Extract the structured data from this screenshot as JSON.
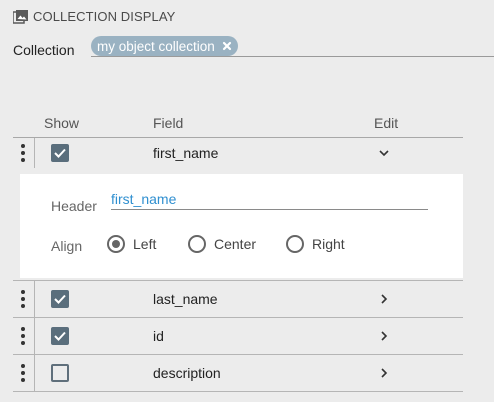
{
  "section": {
    "title": "COLLECTION DISPLAY",
    "icon": "image-icon"
  },
  "collection": {
    "label": "Collection",
    "chip_label": "my object collection",
    "chip_icon": "close-icon"
  },
  "table": {
    "headers": {
      "show": "Show",
      "field": "Field",
      "edit": "Edit"
    },
    "rows": [
      {
        "name": "first_name",
        "checked": true,
        "expanded": true,
        "edit_icon": "chevron-down-icon"
      },
      {
        "name": "last_name",
        "checked": true,
        "expanded": false,
        "edit_icon": "chevron-right-icon"
      },
      {
        "name": "id",
        "checked": true,
        "expanded": false,
        "edit_icon": "chevron-right-icon"
      },
      {
        "name": "description",
        "checked": false,
        "expanded": false,
        "edit_icon": "chevron-right-icon"
      }
    ]
  },
  "detail": {
    "header_label": "Header",
    "header_value": "first_name",
    "align_label": "Align",
    "align_options": [
      "Left",
      "Center",
      "Right"
    ],
    "align_selected": "Left"
  },
  "colors": {
    "chip": "#9ab2c2",
    "checkbox": "#5a6e7c",
    "link": "#2f8fd0",
    "background": "#ececec"
  }
}
